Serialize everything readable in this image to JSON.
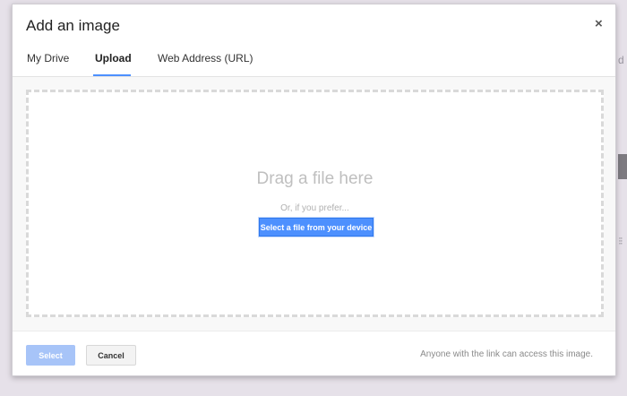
{
  "background": {
    "edge_letter": "d",
    "grip_glyph": "⁝⁝"
  },
  "dialog": {
    "title": "Add an image",
    "close_glyph": "×",
    "tabs": [
      {
        "label": "My Drive"
      },
      {
        "label": "Upload"
      },
      {
        "label": "Web Address (URL)"
      }
    ],
    "active_tab": "Upload",
    "dropzone": {
      "heading": "Drag a file here",
      "subtext": "Or, if you prefer...",
      "button_label": "Select a file from your device"
    },
    "footer": {
      "select_label": "Select",
      "cancel_label": "Cancel",
      "note": "Anyone with the link can access this image."
    }
  },
  "colors": {
    "accent": "#4d90fe",
    "accent_disabled": "#a7c4f8"
  }
}
